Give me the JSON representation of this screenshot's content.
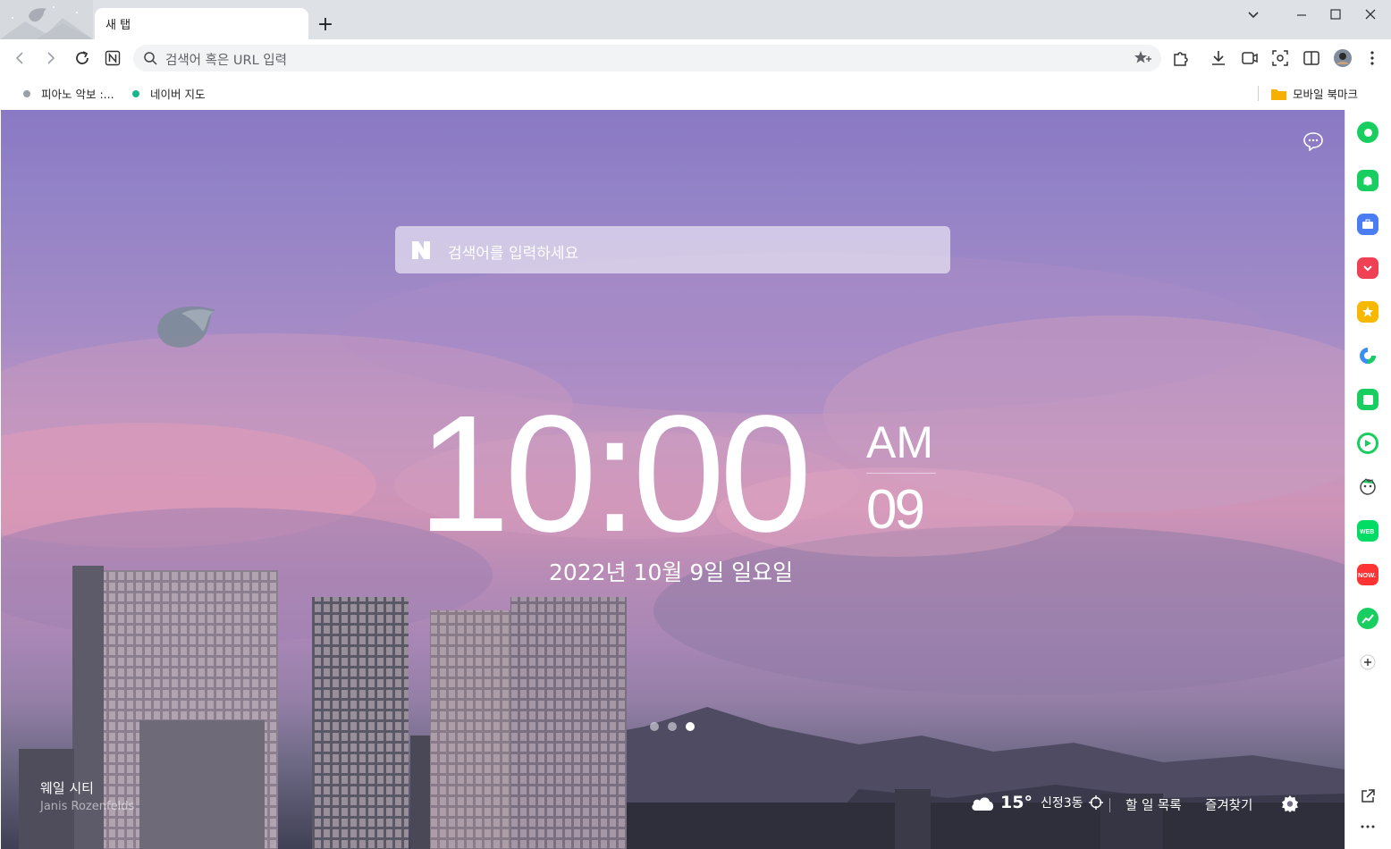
{
  "tab": {
    "title": "새 탭"
  },
  "toolbar": {
    "search_placeholder": "검색어 혹은 URL 입력"
  },
  "bookmarks": {
    "items": [
      {
        "label": "피아노 악보 :...",
        "color": "#9aa0a6"
      },
      {
        "label": "네이버 지도",
        "color": "#19b68c"
      }
    ],
    "mobile_folder": "모바일 북마크"
  },
  "ntp": {
    "search_placeholder": "검색어를 입력하세요",
    "clock": {
      "time": "10:00",
      "ampm": "AM",
      "seconds": "09"
    },
    "date": "2022년 10월 9일 일요일",
    "wallpaper": {
      "title": "웨일 시티",
      "author": "Janis Rozenfelds",
      "page_count": 3,
      "active_page": 3
    },
    "weather": {
      "temp": "15°",
      "location": "신정3동"
    },
    "links": {
      "todo": "할 일 목록",
      "favorites": "즐겨찾기"
    }
  },
  "sidebar": {
    "icons": [
      {
        "name": "green-circle-app-icon",
        "color": "#19ce60"
      },
      {
        "name": "bell-app-icon",
        "color": "#19ce60"
      },
      {
        "name": "toolbox-app-icon",
        "color": "#4a7cf2"
      },
      {
        "name": "pocket-app-icon",
        "color": "#ef4056"
      },
      {
        "name": "star-app-icon",
        "color": "#f6b800"
      },
      {
        "name": "translate-app-icon",
        "color": "#3a8ff5"
      },
      {
        "name": "green-square-app-icon",
        "color": "#19ce60"
      },
      {
        "name": "play-app-icon",
        "color": "#19ce60"
      },
      {
        "name": "character-app-icon",
        "color": "#444444"
      },
      {
        "name": "webtoon-app-icon",
        "color": "#00dc64"
      },
      {
        "name": "now-app-icon",
        "color": "#ff3333"
      },
      {
        "name": "chart-app-icon",
        "color": "#19ce60"
      }
    ]
  },
  "colors": {
    "accent": "#19ce60",
    "tabstrip": "#dee1e6"
  }
}
